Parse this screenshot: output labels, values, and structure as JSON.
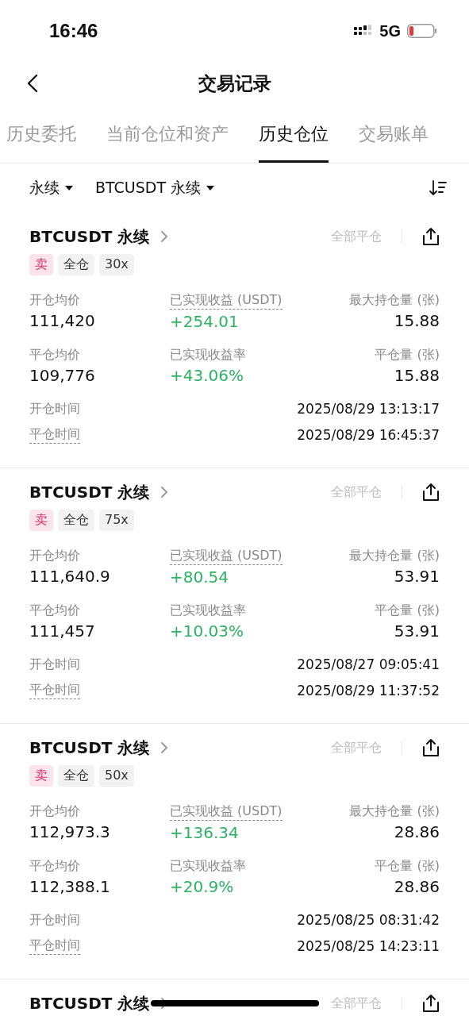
{
  "status_bar": {
    "time": "16:46",
    "network": "5G"
  },
  "nav": {
    "title": "交易记录"
  },
  "tabs": [
    {
      "label": "历史委托",
      "selected": false
    },
    {
      "label": "当前仓位和资产",
      "selected": false
    },
    {
      "label": "历史仓位",
      "selected": true
    },
    {
      "label": "交易账单",
      "selected": false
    }
  ],
  "filters": [
    {
      "label": "永续"
    },
    {
      "label": "BTCUSDT 永续"
    }
  ],
  "positions": [
    {
      "symbol": "BTCUSDT 永续",
      "close_all": "全部平仓",
      "tags": [
        {
          "label": "卖",
          "kind": "sell"
        },
        {
          "label": "全仓",
          "kind": "plain"
        },
        {
          "label": "30x",
          "kind": "plain"
        }
      ],
      "stats": [
        {
          "label": "开仓均价",
          "value": "111,420",
          "dashed": false,
          "kind": "plain"
        },
        {
          "label": "已实现收益 (USDT)",
          "value": "+254.01",
          "dashed": true,
          "kind": "gain"
        },
        {
          "label": "最大持仓量 (张)",
          "value": "15.88",
          "dashed": false,
          "kind": "plain"
        },
        {
          "label": "平仓均价",
          "value": "109,776",
          "dashed": false,
          "kind": "plain"
        },
        {
          "label": "已实现收益率",
          "value": "+43.06%",
          "dashed": false,
          "kind": "gain"
        },
        {
          "label": "平仓量 (张)",
          "value": "15.88",
          "dashed": false,
          "kind": "plain"
        }
      ],
      "times": [
        {
          "label": "开仓时间",
          "value": "2025/08/29 13:13:17",
          "dashed": false
        },
        {
          "label": "平仓时间",
          "value": "2025/08/29 16:45:37",
          "dashed": true
        }
      ]
    },
    {
      "symbol": "BTCUSDT 永续",
      "close_all": "全部平仓",
      "tags": [
        {
          "label": "卖",
          "kind": "sell"
        },
        {
          "label": "全仓",
          "kind": "plain"
        },
        {
          "label": "75x",
          "kind": "plain"
        }
      ],
      "stats": [
        {
          "label": "开仓均价",
          "value": "111,640.9",
          "dashed": false,
          "kind": "plain"
        },
        {
          "label": "已实现收益 (USDT)",
          "value": "+80.54",
          "dashed": true,
          "kind": "gain"
        },
        {
          "label": "最大持仓量 (张)",
          "value": "53.91",
          "dashed": false,
          "kind": "plain"
        },
        {
          "label": "平仓均价",
          "value": "111,457",
          "dashed": false,
          "kind": "plain"
        },
        {
          "label": "已实现收益率",
          "value": "+10.03%",
          "dashed": false,
          "kind": "gain"
        },
        {
          "label": "平仓量 (张)",
          "value": "53.91",
          "dashed": false,
          "kind": "plain"
        }
      ],
      "times": [
        {
          "label": "开仓时间",
          "value": "2025/08/27 09:05:41",
          "dashed": false
        },
        {
          "label": "平仓时间",
          "value": "2025/08/29 11:37:52",
          "dashed": true
        }
      ]
    },
    {
      "symbol": "BTCUSDT 永续",
      "close_all": "全部平仓",
      "tags": [
        {
          "label": "卖",
          "kind": "sell"
        },
        {
          "label": "全仓",
          "kind": "plain"
        },
        {
          "label": "50x",
          "kind": "plain"
        }
      ],
      "stats": [
        {
          "label": "开仓均价",
          "value": "112,973.3",
          "dashed": false,
          "kind": "plain"
        },
        {
          "label": "已实现收益 (USDT)",
          "value": "+136.34",
          "dashed": true,
          "kind": "gain"
        },
        {
          "label": "最大持仓量 (张)",
          "value": "28.86",
          "dashed": false,
          "kind": "plain"
        },
        {
          "label": "平仓均价",
          "value": "112,388.1",
          "dashed": false,
          "kind": "plain"
        },
        {
          "label": "已实现收益率",
          "value": "+20.9%",
          "dashed": false,
          "kind": "gain"
        },
        {
          "label": "平仓量 (张)",
          "value": "28.86",
          "dashed": false,
          "kind": "plain"
        }
      ],
      "times": [
        {
          "label": "开仓时间",
          "value": "2025/08/25 08:31:42",
          "dashed": false
        },
        {
          "label": "平仓时间",
          "value": "2025/08/25 14:23:11",
          "dashed": true
        }
      ]
    },
    {
      "symbol": "BTCUSDT 永续",
      "close_all": "全部平仓"
    }
  ]
}
